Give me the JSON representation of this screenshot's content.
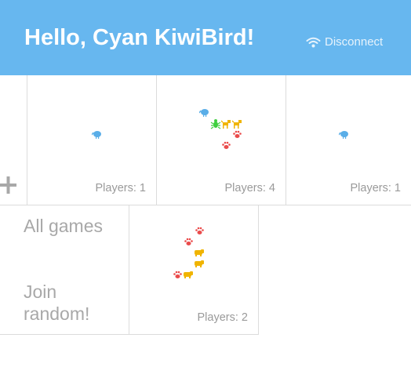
{
  "header": {
    "title": "Hello, Cyan KiwiBird!",
    "disconnect_label": "Disconnect",
    "background_color": "#67b7ef",
    "disconnect_icon": "wifi-icon"
  },
  "lobby": {
    "new_game_icon": "plus-icon",
    "games": [
      {
        "players_label": "Players: 1",
        "avatars": [
          {
            "animal": "kiwi",
            "color": "#5aaee8"
          }
        ]
      },
      {
        "players_label": "Players: 4",
        "avatars": [
          {
            "animal": "kiwi",
            "color": "#5aaee8"
          },
          {
            "animal": "bug",
            "color": "#3fcf3f"
          },
          {
            "animal": "dog",
            "color": "#f0b400"
          },
          {
            "animal": "dog",
            "color": "#f0b400"
          },
          {
            "animal": "paw",
            "color": "#ea4b4b"
          },
          {
            "animal": "paw",
            "color": "#ea4b4b"
          }
        ]
      },
      {
        "players_label": "Players: 1",
        "avatars": [
          {
            "animal": "kiwi",
            "color": "#5aaee8"
          }
        ]
      },
      {
        "players_label": "Players: 2",
        "avatars": [
          {
            "animal": "paw",
            "color": "#ea4b4b"
          },
          {
            "animal": "paw",
            "color": "#ea4b4b"
          },
          {
            "animal": "hippo",
            "color": "#f0b400"
          },
          {
            "animal": "hippo",
            "color": "#f0b400"
          },
          {
            "animal": "paw",
            "color": "#ea4b4b"
          },
          {
            "animal": "hippo",
            "color": "#f0b400"
          }
        ]
      }
    ]
  },
  "menu": {
    "all_games": "All games",
    "join_random_line1": "Join",
    "join_random_line2": "random!"
  }
}
